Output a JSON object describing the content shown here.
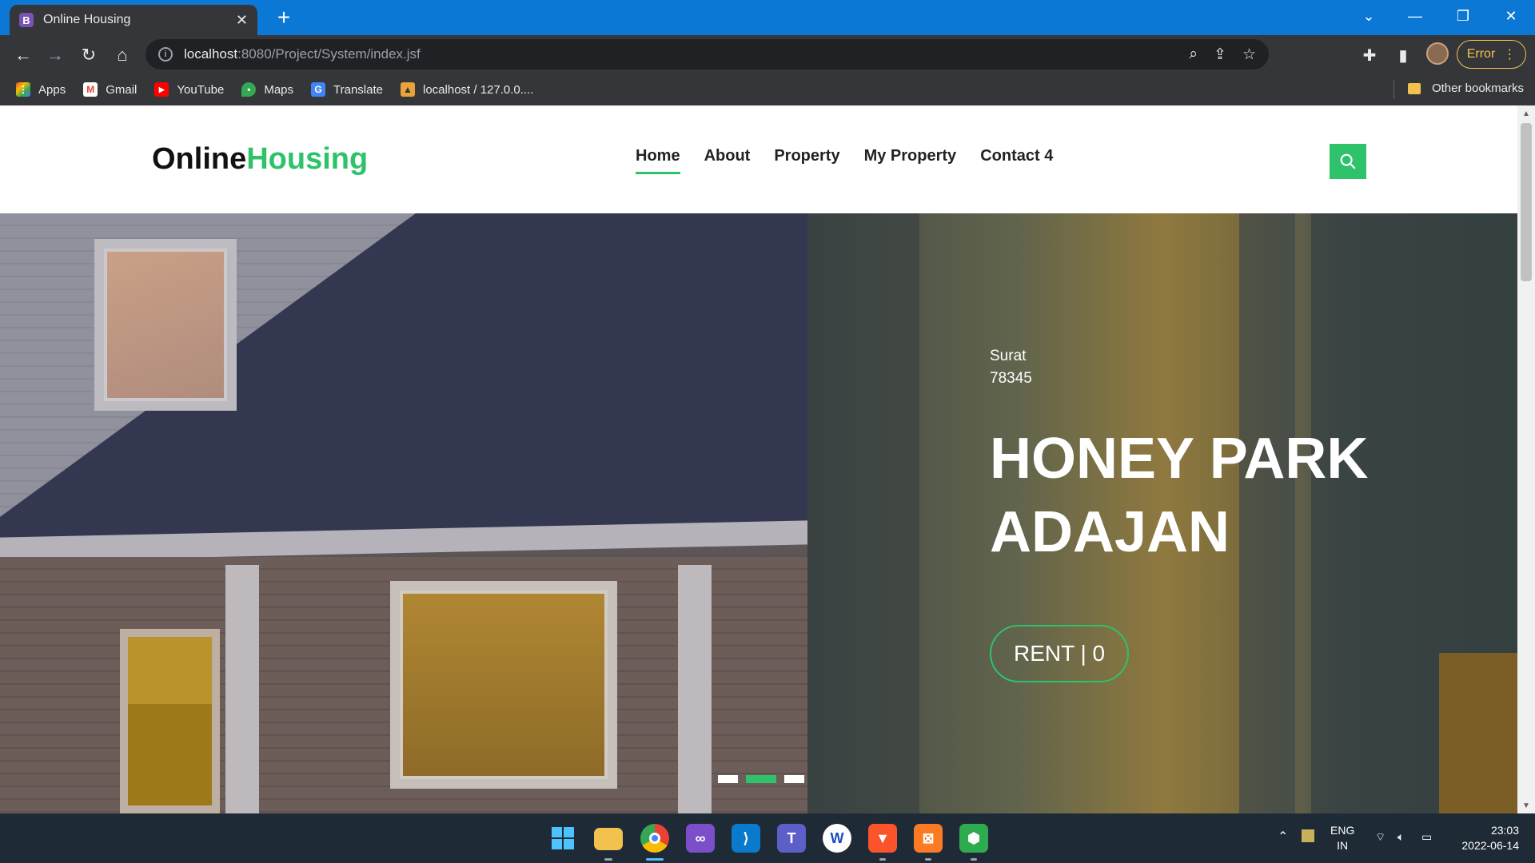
{
  "browser": {
    "tab_title": "Online Housing",
    "tab_favicon": "B",
    "url_host": "localhost",
    "url_path": ":8080/Project/System/index.jsf",
    "error_label": "Error",
    "bookmarks": [
      "Apps",
      "Gmail",
      "YouTube",
      "Maps",
      "Translate",
      "localhost / 127.0.0...."
    ],
    "other_bookmarks": "Other bookmarks"
  },
  "site": {
    "logo_primary": "Online",
    "logo_accent": "Housing",
    "accent_color": "#2ec26a",
    "nav": [
      {
        "label": "Home",
        "active": true
      },
      {
        "label": "About"
      },
      {
        "label": "Property"
      },
      {
        "label": "My Property"
      },
      {
        "label": "Contact 4"
      }
    ],
    "hero": {
      "city": "Surat",
      "zip": "78345",
      "title_line1": "HONEY PARK",
      "title_line2": "ADAJAN",
      "rent_button": "RENT | 0",
      "slide_count": 3,
      "active_slide": 2
    }
  },
  "taskbar": {
    "language": "ENG",
    "region": "IN",
    "time": "23:03",
    "date": "2022-06-14"
  }
}
